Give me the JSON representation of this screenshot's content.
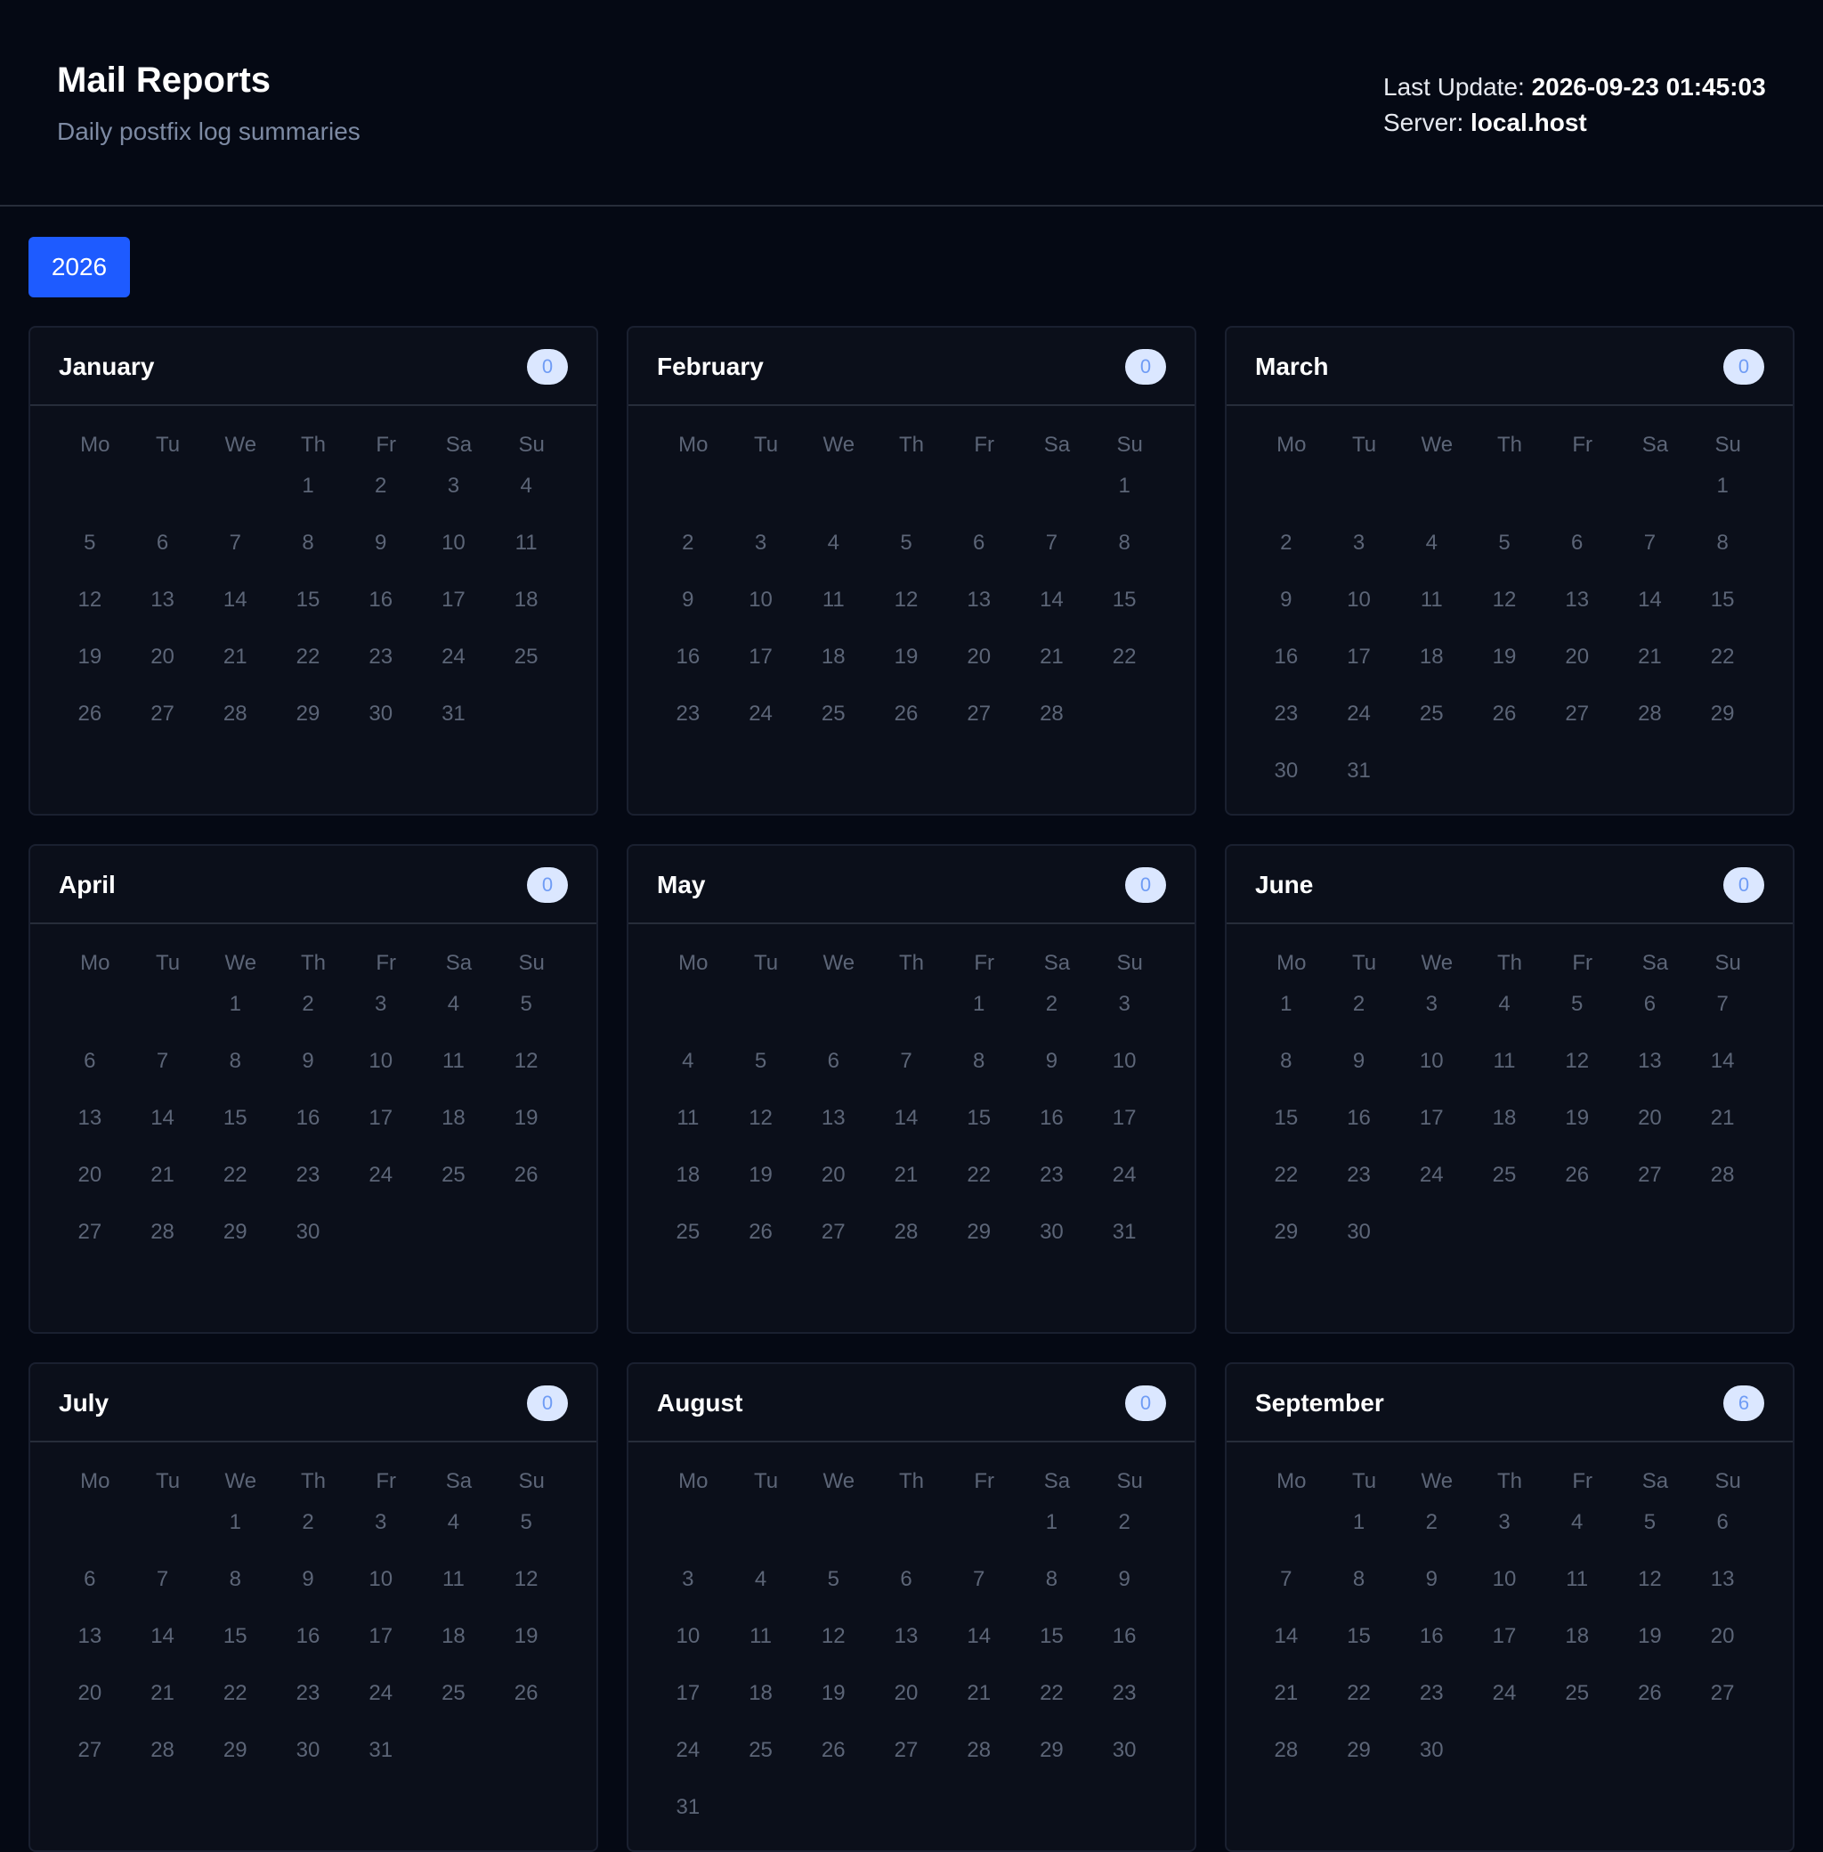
{
  "header": {
    "title": "Mail Reports",
    "subtitle": "Daily postfix log summaries",
    "last_update_label": "Last Update:",
    "last_update_value": "2026-09-23 01:45:03",
    "server_label": "Server:",
    "server_value": "local.host"
  },
  "years": [
    "2026"
  ],
  "weekdays": [
    "Mo",
    "Tu",
    "We",
    "Th",
    "Fr",
    "Sa",
    "Su"
  ],
  "months": [
    {
      "name": "January",
      "count": "0",
      "offset": 3,
      "days": 31
    },
    {
      "name": "February",
      "count": "0",
      "offset": 6,
      "days": 28
    },
    {
      "name": "March",
      "count": "0",
      "offset": 6,
      "days": 31
    },
    {
      "name": "April",
      "count": "0",
      "offset": 2,
      "days": 30
    },
    {
      "name": "May",
      "count": "0",
      "offset": 4,
      "days": 31
    },
    {
      "name": "June",
      "count": "0",
      "offset": 0,
      "days": 30
    },
    {
      "name": "July",
      "count": "0",
      "offset": 2,
      "days": 31
    },
    {
      "name": "August",
      "count": "0",
      "offset": 5,
      "days": 31
    },
    {
      "name": "September",
      "count": "6",
      "offset": 1,
      "days": 30
    }
  ],
  "colors": {
    "background": "#050914",
    "card": "#0b0f1a",
    "accent": "#1e5bff",
    "badge_bg": "#dbe7ff",
    "badge_text": "#6f9cf5",
    "muted_text": "#5c6577"
  }
}
